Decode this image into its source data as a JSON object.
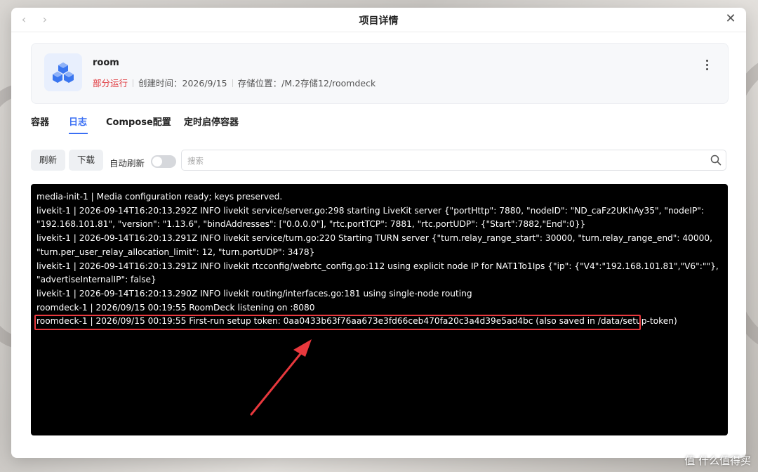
{
  "window": {
    "title": "项目详情",
    "back_icon": "chevron-left-icon",
    "forward_icon": "chevron-right-icon",
    "close_icon": "close-icon"
  },
  "project": {
    "name": "room",
    "status": "部分运行",
    "created": "创建时间：2026/9/15",
    "storage": "存储位置：/M.2存储12/roomdeck",
    "icon": "cubes-icon",
    "more_icon": "more-vertical-icon",
    "status_color": "#e0393e"
  },
  "tabs": [
    {
      "label": "容器"
    },
    {
      "label": "日志"
    },
    {
      "label": "Compose配置"
    },
    {
      "label": "定时启停容器"
    }
  ],
  "active_tab": "日志",
  "toolbar": {
    "refresh_label": "刷新",
    "download_label": "下载",
    "auto_refresh_label": "自动刷新",
    "auto_refresh_on": false,
    "search_placeholder": "搜索",
    "search_icon": "search-icon"
  },
  "logs": [
    "media-init-1  | Media configuration ready; keys preserved.",
    "livekit-1   | 2026-09-14T16:20:13.292Z    INFO    livekit   service/server.go:298    starting LiveKit server   {\"portHttp\": 7880, \"nodeID\": \"ND_caFz2UKhAy35\", \"nodeIP\": \"192.168.101.81\", \"version\": \"1.13.6\", \"bindAddresses\": [\"0.0.0.0\"], \"rtc.portTCP\": 7881, \"rtc.portUDP\": {\"Start\":7882,\"End\":0}}",
    "livekit-1   | 2026-09-14T16:20:13.291Z    INFO    livekit   service/turn.go:220      Starting TURN server    {\"turn.relay_range_start\": 30000, \"turn.relay_range_end\": 40000, \"turn.per_user_relay_allocation_limit\": 12, \"turn.portUDP\": 3478}",
    "livekit-1   | 2026-09-14T16:20:13.291Z    INFO    livekit   rtcconfig/webrtc_config.go:112      using explicit node IP for NAT1To1Ips   {\"ip\": {\"V4\":\"192.168.101.81\",\"V6\":\"\"}, \"advertiseInternalIP\": false}",
    "livekit-1   | 2026-09-14T16:20:13.290Z    INFO    livekit   routing/interfaces.go:181   using single-node routing",
    "roomdeck-1  | 2026/09/15 00:19:55 RoomDeck listening on :8080",
    "roomdeck-1  | 2026/09/15 00:19:55 First-run setup token: 0aa0433b63f76aa673e3fd66ceb470fa20c3a4d39e5ad4bc (also saved in /data/setup-token)"
  ],
  "highlight_color": "#e8383d",
  "watermark": "值 什么值得买",
  "accent_color": "#3a6ff4"
}
